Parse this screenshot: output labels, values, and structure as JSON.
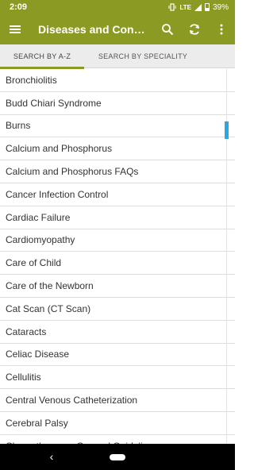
{
  "status_bar": {
    "time": "2:09",
    "network": "LTE",
    "battery": "39%"
  },
  "app_bar": {
    "title": "Diseases and Conditions",
    "actions": [
      "search-icon",
      "refresh-icon",
      "more-vert-icon"
    ]
  },
  "tabs": [
    {
      "label": "SEARCH BY A-Z",
      "selected": true
    },
    {
      "label": "SEARCH BY SPECIALITY",
      "selected": false
    }
  ],
  "list": {
    "items": [
      "Bronchiolitis",
      "Budd Chiari Syndrome",
      "Burns",
      "Calcium and Phosphorus",
      "Calcium and Phosphorus FAQs",
      "Cancer Infection Control",
      "Cardiac Failure",
      "Cardiomyopathy",
      "Care of Child",
      "Care of the Newborn",
      "Cat Scan (CT Scan)",
      "Cataracts",
      "Celiac Disease",
      "Cellulitis",
      "Central Venous Catheterization",
      "Cerebral Palsy",
      "Chemotherapy - General Guidelines"
    ]
  },
  "colors": {
    "primary": "#8a9a22",
    "scroll_accent": "#29a9e1",
    "tab_bg": "#ececec"
  }
}
